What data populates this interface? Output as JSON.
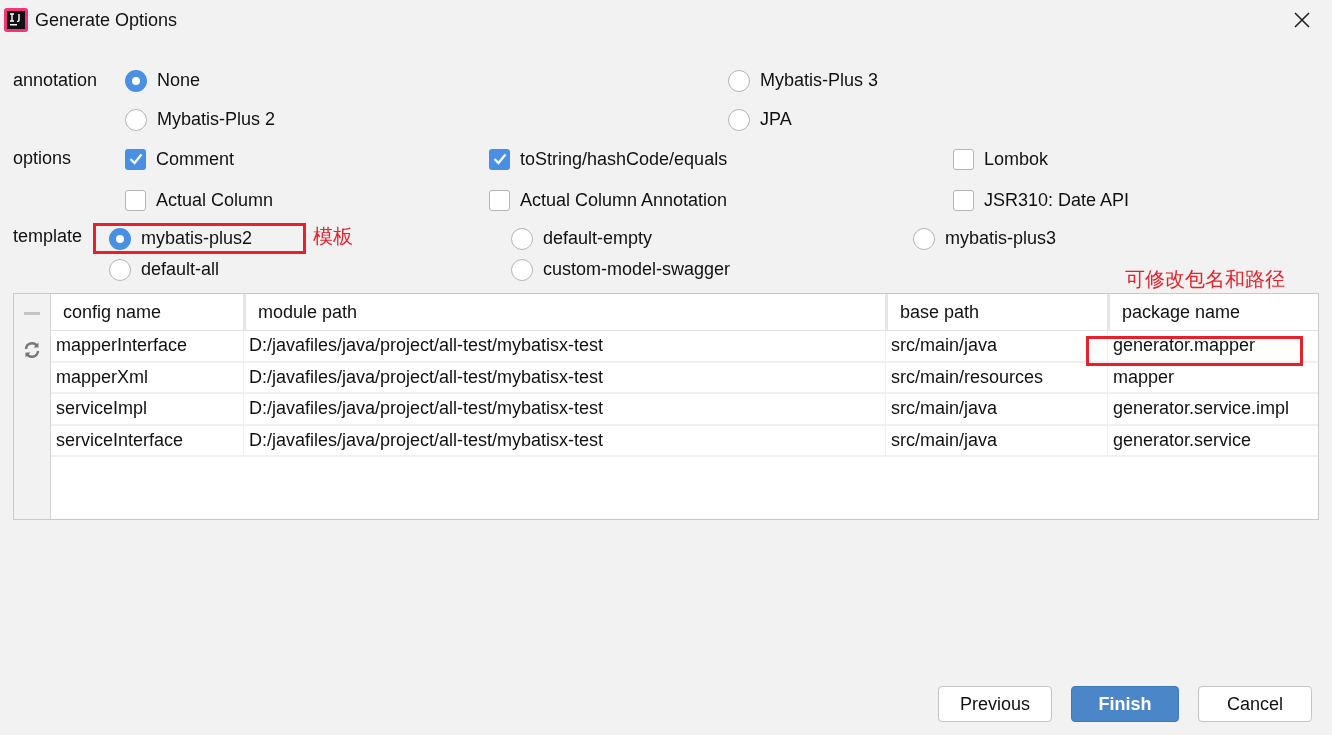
{
  "window": {
    "title": "Generate Options"
  },
  "annotation": {
    "label": "annotation",
    "options": [
      {
        "label": "None",
        "selected": true
      },
      {
        "label": "Mybatis-Plus 3",
        "selected": false
      },
      {
        "label": "Mybatis-Plus 2",
        "selected": false
      },
      {
        "label": "JPA",
        "selected": false
      }
    ]
  },
  "options": {
    "label": "options",
    "items": [
      {
        "label": "Comment",
        "checked": true
      },
      {
        "label": "toString/hashCode/equals",
        "checked": true
      },
      {
        "label": "Lombok",
        "checked": false
      },
      {
        "label": "Actual Column",
        "checked": false
      },
      {
        "label": "Actual Column Annotation",
        "checked": false
      },
      {
        "label": "JSR310: Date API",
        "checked": false
      }
    ]
  },
  "template": {
    "label": "template",
    "note": "模板",
    "options": [
      {
        "label": "mybatis-plus2",
        "selected": true,
        "highlighted": true
      },
      {
        "label": "default-empty",
        "selected": false,
        "highlighted": false
      },
      {
        "label": "mybatis-plus3",
        "selected": false,
        "highlighted": false
      },
      {
        "label": "default-all",
        "selected": false,
        "highlighted": false
      },
      {
        "label": "custom-model-swagger",
        "selected": false,
        "highlighted": false
      }
    ]
  },
  "table": {
    "note": "可修改包名和路径",
    "columns": [
      "config name",
      "module path",
      "base path",
      "package name"
    ],
    "rows": [
      [
        "mapperInterface",
        "D:/javafiles/java/project/all-test/mybatisx-test",
        "src/main/java",
        "generator.mapper"
      ],
      [
        "mapperXml",
        "D:/javafiles/java/project/all-test/mybatisx-test",
        "src/main/resources",
        "mapper"
      ],
      [
        "serviceImpl",
        "D:/javafiles/java/project/all-test/mybatisx-test",
        "src/main/java",
        "generator.service.impl"
      ],
      [
        "serviceInterface",
        "D:/javafiles/java/project/all-test/mybatisx-test",
        "src/main/java",
        "generator.service"
      ]
    ]
  },
  "buttons": [
    {
      "label": "Previous",
      "kind": "secondary"
    },
    {
      "label": "Finish",
      "kind": "primary"
    },
    {
      "label": "Cancel",
      "kind": "secondary"
    }
  ]
}
